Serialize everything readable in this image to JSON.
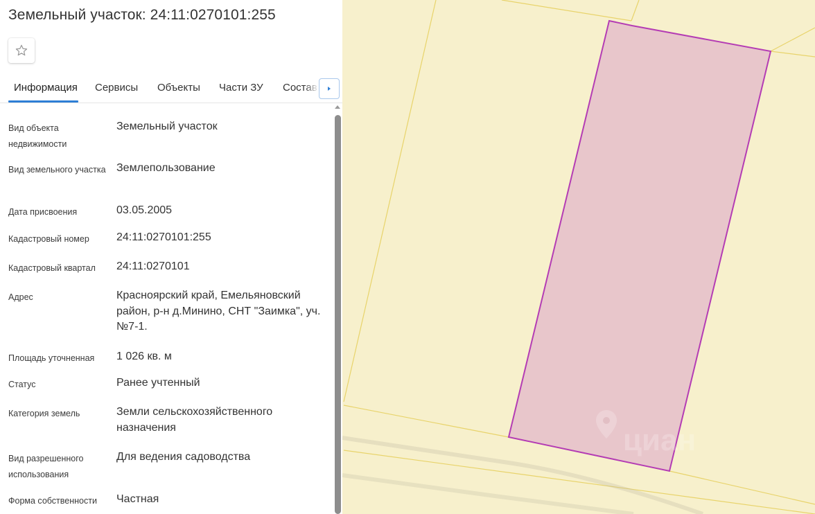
{
  "header": {
    "title": "Земельный участок: 24:11:0270101:255"
  },
  "toolbar": {
    "favorite_icon": "star-outline-icon"
  },
  "tabs": [
    {
      "label": "Информация",
      "active": true
    },
    {
      "label": "Сервисы",
      "active": false
    },
    {
      "label": "Объекты",
      "active": false
    },
    {
      "label": "Части ЗУ",
      "active": false
    },
    {
      "label": "Состав",
      "active": false
    }
  ],
  "tabs_next_icon": "caret-right-icon",
  "info": {
    "rows": [
      {
        "label": "Вид объекта недвижимости",
        "value": "Земельный участок"
      },
      {
        "label": "Вид земельного участка",
        "value": "Землепользование"
      },
      {
        "label": "Дата присвоения",
        "value": "03.05.2005"
      },
      {
        "label": "Кадастровый номер",
        "value": "24:11:0270101:255"
      },
      {
        "label": "Кадастровый квартал",
        "value": "24:11:0270101"
      },
      {
        "label": "Адрес",
        "value": "Красноярский край, Емельяновский район, р-н д.Минино, СНТ \"Заимка\", уч.№7-1."
      },
      {
        "label": "Площадь уточненная",
        "value": "1 026 кв. м"
      },
      {
        "label": "Статус",
        "value": "Ранее учтенный"
      },
      {
        "label": "Категория земель",
        "value": "Земли сельскохозяйственного назначения"
      },
      {
        "label": "Вид разрешенного использования",
        "value": "Для ведения садоводства"
      },
      {
        "label": "Форма собственности",
        "value": "Частная"
      }
    ]
  },
  "map": {
    "background_color": "#f7f0cc",
    "boundary_line_color": "#e8d36a",
    "parcel_fill_color": "#e8c6cb",
    "parcel_stroke_color": "#b43cb4",
    "watermark_icon": "location-pin-icon",
    "watermark": "циан"
  }
}
